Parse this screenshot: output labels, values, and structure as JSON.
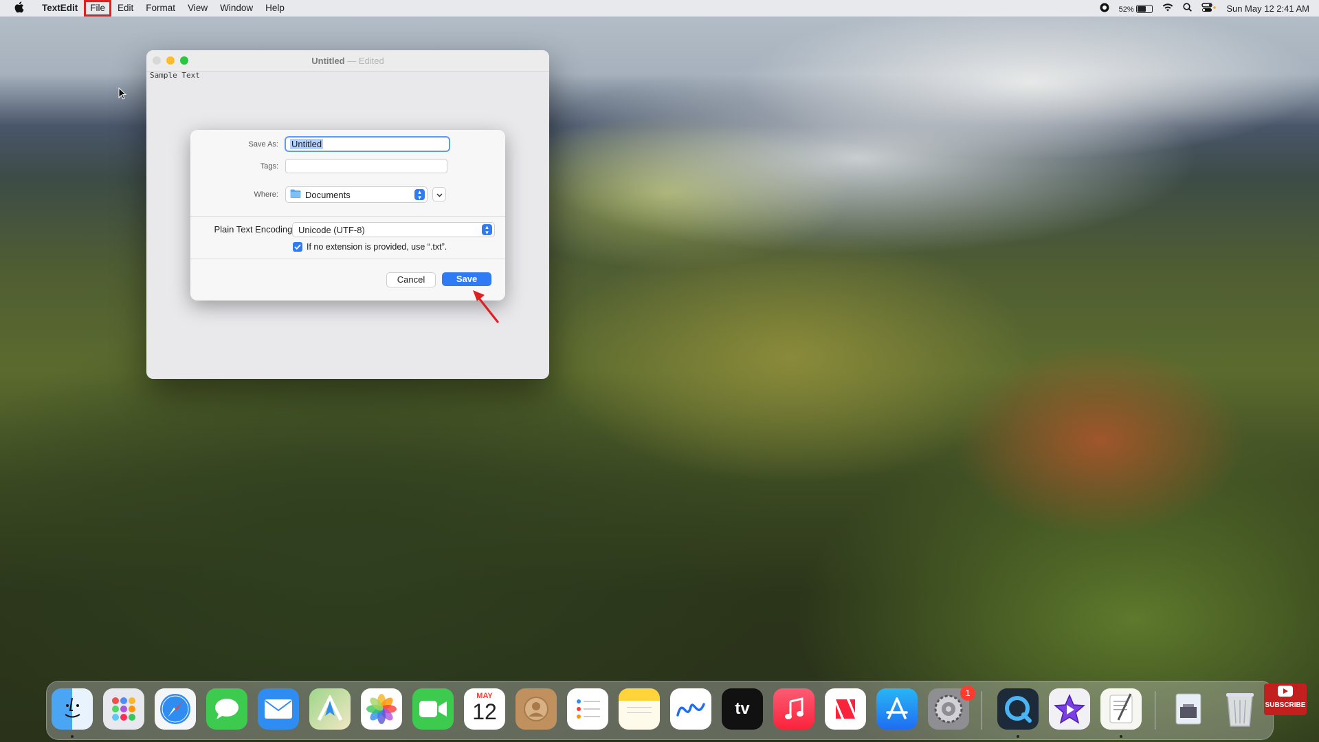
{
  "menubar": {
    "app_name": "TextEdit",
    "menus": [
      "File",
      "Edit",
      "Format",
      "View",
      "Window",
      "Help"
    ],
    "highlighted_menu": "File",
    "battery_percent": "52%",
    "battery_level": 0.52,
    "datetime": "Sun May 12  2:41 AM"
  },
  "window": {
    "title": "Untitled",
    "title_separator": "—",
    "edited_label": "Edited",
    "content_text": "Sample Text"
  },
  "save_sheet": {
    "save_as_label": "Save As:",
    "save_as_value": "Untitled",
    "tags_label": "Tags:",
    "tags_value": "",
    "where_label": "Where:",
    "where_value": "Documents",
    "encoding_label": "Plain Text Encoding:",
    "encoding_value": "Unicode (UTF-8)",
    "extension_checkbox_label": "If no extension is provided, use “.txt”.",
    "extension_checkbox_checked": true,
    "cancel_label": "Cancel",
    "save_label": "Save"
  },
  "dock": {
    "apps": [
      "Finder",
      "Launchpad",
      "Safari",
      "Messages",
      "Mail",
      "Maps",
      "Photos",
      "FaceTime",
      "Calendar",
      "Contacts",
      "Reminders",
      "Notes",
      "Freeform",
      "TV",
      "Music",
      "News",
      "App Store",
      "System Settings",
      "QuickTime Player",
      "iMovie",
      "TextEdit",
      "Preview",
      "Trash"
    ],
    "calendar_month": "MAY",
    "calendar_day": "12",
    "tv_label": "tv",
    "settings_badge": "1",
    "subscribe_label": "SUBSCRIBE"
  },
  "colors": {
    "accent": "#2f7bf5",
    "highlight_outline": "#e02020",
    "annotation_arrow": "#e02020"
  }
}
